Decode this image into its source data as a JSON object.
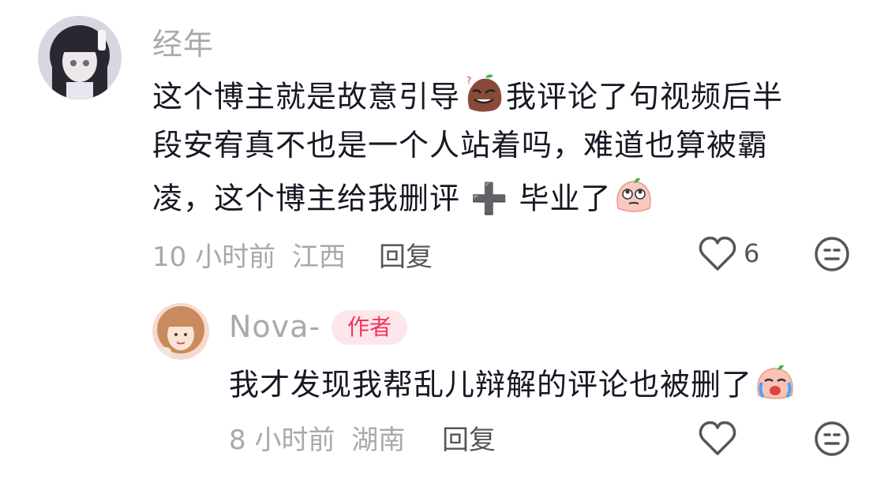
{
  "comments": [
    {
      "username": "经年",
      "lines": [
        {
          "before": "这个博主就是故意引导",
          "emoji": "mischievous-emoji",
          "after": "我评论了句视频后半"
        },
        {
          "text": "段安宥真不也是一个人站着吗，难道也算被霸"
        },
        {
          "before": "凌，这个博主给我删评 ",
          "plus": "➕",
          "middle": " 毕业了",
          "emoji": "eyeroll-emoji"
        }
      ],
      "time": "10 小时前",
      "location": "江西",
      "reply_label": "回复",
      "like_count": "6"
    }
  ],
  "reply": {
    "username": "Nova-",
    "badge": "作者",
    "text": "我才发现我帮乱儿辩解的评论也被删了",
    "emoji": "crying-emoji",
    "time": "8 小时前",
    "location": "湖南",
    "reply_label": "回复"
  },
  "colors": {
    "secondary_text": "#a9a9ad",
    "primary_text": "#161823",
    "badge_bg": "#fde6ea",
    "badge_text": "#f0355b"
  }
}
